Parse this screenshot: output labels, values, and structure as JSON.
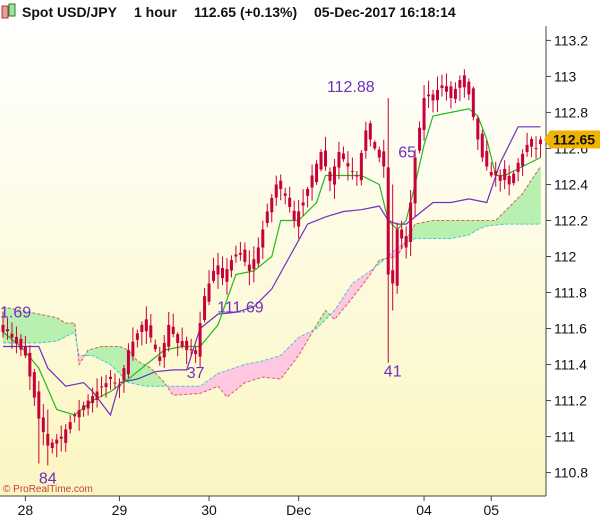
{
  "header": {
    "symbol": "Spot USD/JPY",
    "timeframe": "1 hour",
    "price_change": "112.65 (+0.13%)",
    "datetime": "05-Dec-2017 16:18:14",
    "icon": "chart-toggle-icon"
  },
  "watermark": "© ProRealTime.com",
  "colors": {
    "candle": "#c8003c",
    "kijun": "#7030c0",
    "tenkan": "#22bb22",
    "cloud_bull": "#b8f0b0",
    "cloud_bear": "#ffc8e0",
    "span_a": "#d06060",
    "span_b": "#40c8d8",
    "annotation": "#7030c0",
    "price_tag": "#f0b400"
  },
  "chart_data": {
    "type": "candlestick",
    "ylim": [
      110.67,
      113.28
    ],
    "y_ticks": [
      "113.2",
      "113",
      "112.8",
      "112.6",
      "112.4",
      "112.2",
      "112",
      "111.8",
      "111.6",
      "111.4",
      "111.2",
      "111",
      "110.8"
    ],
    "x_ticks": [
      {
        "label": "28",
        "bar": 5
      },
      {
        "label": "29",
        "bar": 26
      },
      {
        "label": "30",
        "bar": 46
      },
      {
        "label": "Dec",
        "bar": 66
      },
      {
        "label": "04",
        "bar": 94
      },
      {
        "label": "05",
        "bar": 109
      }
    ],
    "total_bars": 121,
    "last_price": "112.65",
    "annotations": [
      {
        "text": "1.69",
        "bar": 1,
        "value": 111.69
      },
      {
        "text": "84",
        "bar": 10,
        "value": 110.84
      },
      {
        "text": "37",
        "bar": 43,
        "value": 111.37
      },
      {
        "text": "111.69",
        "bar": 53,
        "value": 111.69
      },
      {
        "text": "112.88",
        "bar": 81,
        "value": 112.88
      },
      {
        "text": "41",
        "bar": 87,
        "value": 111.41
      },
      {
        "text": "65",
        "bar": 92,
        "value": 112.65
      }
    ],
    "series": {
      "close_path": [
        [
          0,
          111.62
        ],
        [
          2,
          111.55
        ],
        [
          5,
          111.45
        ],
        [
          8,
          111.1
        ],
        [
          10,
          110.95
        ],
        [
          13,
          111.0
        ],
        [
          16,
          111.12
        ],
        [
          19,
          111.2
        ],
        [
          21,
          111.25
        ],
        [
          24,
          111.32
        ],
        [
          26,
          111.28
        ],
        [
          28,
          111.48
        ],
        [
          31,
          111.62
        ],
        [
          33,
          111.55
        ],
        [
          35,
          111.42
        ],
        [
          37,
          111.62
        ],
        [
          39,
          111.52
        ],
        [
          41,
          111.48
        ],
        [
          43,
          111.48
        ],
        [
          45,
          111.78
        ],
        [
          47,
          111.92
        ],
        [
          49,
          111.88
        ],
        [
          51,
          111.98
        ],
        [
          53,
          112.02
        ],
        [
          55,
          111.92
        ],
        [
          57,
          112.05
        ],
        [
          59,
          112.25
        ],
        [
          61,
          112.4
        ],
        [
          63,
          112.35
        ],
        [
          65,
          112.2
        ],
        [
          67,
          112.3
        ],
        [
          69,
          112.45
        ],
        [
          71,
          112.58
        ],
        [
          73,
          112.42
        ],
        [
          75,
          112.58
        ],
        [
          77,
          112.5
        ],
        [
          79,
          112.45
        ],
        [
          81,
          112.7
        ],
        [
          83,
          112.6
        ],
        [
          85,
          112.5
        ],
        [
          86,
          111.9
        ],
        [
          87,
          111.85
        ],
        [
          88,
          112.15
        ],
        [
          90,
          112.05
        ],
        [
          92,
          112.55
        ],
        [
          94,
          112.88
        ],
        [
          96,
          112.9
        ],
        [
          98,
          112.95
        ],
        [
          100,
          112.88
        ],
        [
          102,
          112.98
        ],
        [
          104,
          112.9
        ],
        [
          106,
          112.65
        ],
        [
          107,
          112.55
        ],
        [
          109,
          112.45
        ],
        [
          111,
          112.45
        ],
        [
          113,
          112.4
        ],
        [
          115,
          112.52
        ],
        [
          117,
          112.62
        ],
        [
          119,
          112.6
        ],
        [
          120,
          112.65
        ]
      ],
      "tenkan": [
        [
          0,
          111.58
        ],
        [
          4,
          111.5
        ],
        [
          8,
          111.38
        ],
        [
          12,
          111.15
        ],
        [
          16,
          111.12
        ],
        [
          20,
          111.2
        ],
        [
          24,
          111.25
        ],
        [
          28,
          111.32
        ],
        [
          32,
          111.4
        ],
        [
          36,
          111.48
        ],
        [
          40,
          111.5
        ],
        [
          44,
          111.5
        ],
        [
          48,
          111.62
        ],
        [
          52,
          111.9
        ],
        [
          56,
          111.92
        ],
        [
          60,
          112.0
        ],
        [
          62,
          112.2
        ],
        [
          66,
          112.2
        ],
        [
          70,
          112.3
        ],
        [
          72,
          112.45
        ],
        [
          76,
          112.45
        ],
        [
          80,
          112.45
        ],
        [
          84,
          112.4
        ],
        [
          86,
          112.2
        ],
        [
          88,
          112.15
        ],
        [
          90,
          112.2
        ],
        [
          92,
          112.4
        ],
        [
          94,
          112.62
        ],
        [
          96,
          112.78
        ],
        [
          100,
          112.8
        ],
        [
          104,
          112.82
        ],
        [
          106,
          112.78
        ],
        [
          108,
          112.65
        ],
        [
          110,
          112.45
        ],
        [
          112,
          112.45
        ],
        [
          116,
          112.5
        ],
        [
          120,
          112.55
        ]
      ],
      "kijun": [
        [
          0,
          111.5
        ],
        [
          8,
          111.5
        ],
        [
          10,
          111.38
        ],
        [
          14,
          111.28
        ],
        [
          18,
          111.3
        ],
        [
          20,
          111.25
        ],
        [
          24,
          111.12
        ],
        [
          26,
          111.3
        ],
        [
          30,
          111.32
        ],
        [
          34,
          111.36
        ],
        [
          38,
          111.37
        ],
        [
          41,
          111.37
        ],
        [
          44,
          111.6
        ],
        [
          48,
          111.68
        ],
        [
          52,
          111.69
        ],
        [
          56,
          111.72
        ],
        [
          60,
          111.82
        ],
        [
          64,
          112.0
        ],
        [
          68,
          112.18
        ],
        [
          72,
          112.22
        ],
        [
          76,
          112.25
        ],
        [
          80,
          112.26
        ],
        [
          84,
          112.28
        ],
        [
          86,
          112.2
        ],
        [
          88,
          112.18
        ],
        [
          90,
          112.18
        ],
        [
          92,
          112.22
        ],
        [
          96,
          112.3
        ],
        [
          100,
          112.3
        ],
        [
          104,
          112.32
        ],
        [
          108,
          112.3
        ],
        [
          111,
          112.52
        ],
        [
          115,
          112.72
        ],
        [
          120,
          112.72
        ]
      ],
      "span_a": [
        [
          0,
          111.72
        ],
        [
          4,
          111.7
        ],
        [
          8,
          111.68
        ],
        [
          12,
          111.66
        ],
        [
          14,
          111.63
        ],
        [
          16,
          111.63
        ],
        [
          17,
          111.4
        ],
        [
          19,
          111.48
        ],
        [
          22,
          111.5
        ],
        [
          26,
          111.5
        ],
        [
          28,
          111.48
        ],
        [
          30,
          111.42
        ],
        [
          33,
          111.38
        ],
        [
          36,
          111.3
        ],
        [
          38,
          111.23
        ],
        [
          44,
          111.24
        ],
        [
          48,
          111.28
        ],
        [
          50,
          111.22
        ],
        [
          54,
          111.3
        ],
        [
          58,
          111.33
        ],
        [
          62,
          111.32
        ],
        [
          66,
          111.45
        ],
        [
          70,
          111.62
        ],
        [
          72,
          111.7
        ],
        [
          74,
          111.65
        ],
        [
          78,
          111.77
        ],
        [
          82,
          111.9
        ],
        [
          84,
          111.98
        ],
        [
          88,
          112.0
        ],
        [
          92,
          112.18
        ],
        [
          96,
          112.2
        ],
        [
          100,
          112.2
        ],
        [
          104,
          112.2
        ],
        [
          106,
          112.2
        ],
        [
          110,
          112.2
        ],
        [
          112,
          112.25
        ],
        [
          116,
          112.35
        ],
        [
          120,
          112.5
        ]
      ],
      "span_b": [
        [
          0,
          111.52
        ],
        [
          8,
          111.52
        ],
        [
          12,
          111.53
        ],
        [
          16,
          111.58
        ],
        [
          17,
          111.45
        ],
        [
          20,
          111.45
        ],
        [
          24,
          111.4
        ],
        [
          28,
          111.3
        ],
        [
          32,
          111.28
        ],
        [
          36,
          111.28
        ],
        [
          40,
          111.28
        ],
        [
          44,
          111.28
        ],
        [
          48,
          111.35
        ],
        [
          54,
          111.4
        ],
        [
          58,
          111.42
        ],
        [
          62,
          111.45
        ],
        [
          66,
          111.55
        ],
        [
          70,
          111.6
        ],
        [
          74,
          111.7
        ],
        [
          78,
          111.85
        ],
        [
          82,
          111.92
        ],
        [
          86,
          112.0
        ],
        [
          88,
          112.05
        ],
        [
          92,
          112.1
        ],
        [
          96,
          112.1
        ],
        [
          100,
          112.1
        ],
        [
          104,
          112.12
        ],
        [
          106,
          112.15
        ],
        [
          108,
          112.17
        ],
        [
          112,
          112.18
        ],
        [
          116,
          112.18
        ],
        [
          120,
          112.18
        ]
      ]
    }
  }
}
